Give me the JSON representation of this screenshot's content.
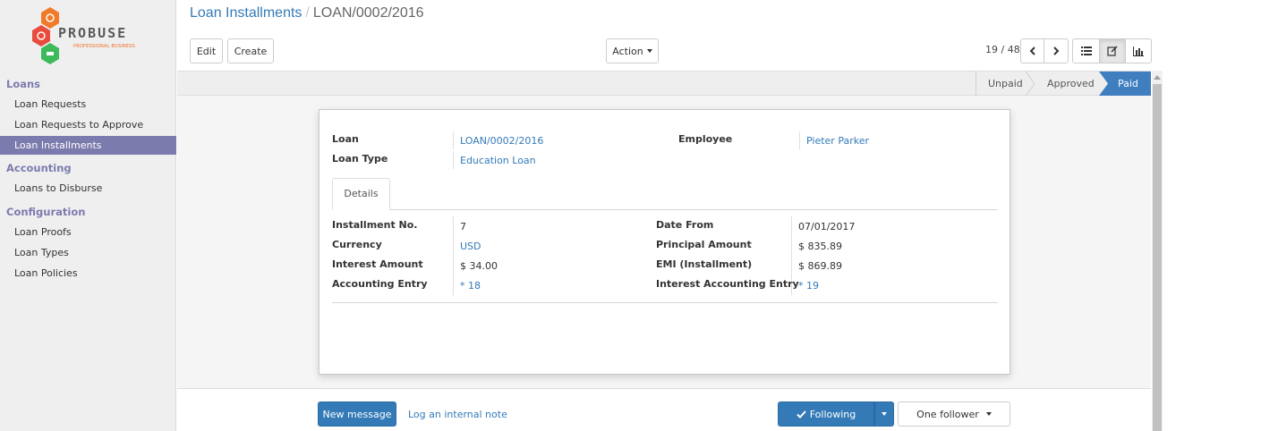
{
  "brand": {
    "name": "PROBUSE",
    "tagline": "PROFESSIONAL BUSINESS",
    "colors": {
      "orange": "#f07a2a",
      "red": "#e84c3d",
      "green": "#3dbb5c"
    }
  },
  "sidebar": {
    "sections": [
      {
        "title": "Loans",
        "items": [
          "Loan Requests",
          "Loan Requests to Approve",
          "Loan Installments"
        ]
      },
      {
        "title": "Accounting",
        "items": [
          "Loans to Disburse"
        ]
      },
      {
        "title": "Configuration",
        "items": [
          "Loan Proofs",
          "Loan Types",
          "Loan Policies"
        ]
      }
    ],
    "active_item": "Loan Installments"
  },
  "breadcrumb": {
    "parent": "Loan Installments",
    "separator": "/",
    "current": "LOAN/0002/2016"
  },
  "toolbar": {
    "edit_label": "Edit",
    "create_label": "Create",
    "action_label": "Action"
  },
  "pager": {
    "text": "19 / 48"
  },
  "statusbar": {
    "stages": [
      "Unpaid",
      "Approved",
      "Paid"
    ],
    "current": "Paid",
    "accent": "#3f7fc0"
  },
  "form": {
    "loan_label": "Loan",
    "loan_value": "LOAN/0002/2016",
    "loan_type_label": "Loan Type",
    "loan_type_value": "Education Loan",
    "employee_label": "Employee",
    "employee_value": "Pieter Parker",
    "tab_details": "Details",
    "installment_no_label": "Installment No.",
    "installment_no_value": "7",
    "currency_label": "Currency",
    "currency_value": "USD",
    "interest_amount_label": "Interest Amount",
    "interest_amount_value": "$ 34.00",
    "accounting_entry_label": "Accounting Entry",
    "accounting_entry_value": "* 18",
    "date_from_label": "Date From",
    "date_from_value": "07/01/2017",
    "principal_amount_label": "Principal Amount",
    "principal_amount_value": "$ 835.89",
    "emi_label": "EMI (Installment)",
    "emi_value": "$ 869.89",
    "interest_accounting_entry_label": "Interest Accounting Entry",
    "interest_accounting_entry_value": "* 19"
  },
  "chatter": {
    "new_message_label": "New message",
    "log_note_label": "Log an internal note",
    "following_label": "Following",
    "followers_label": "One follower"
  }
}
